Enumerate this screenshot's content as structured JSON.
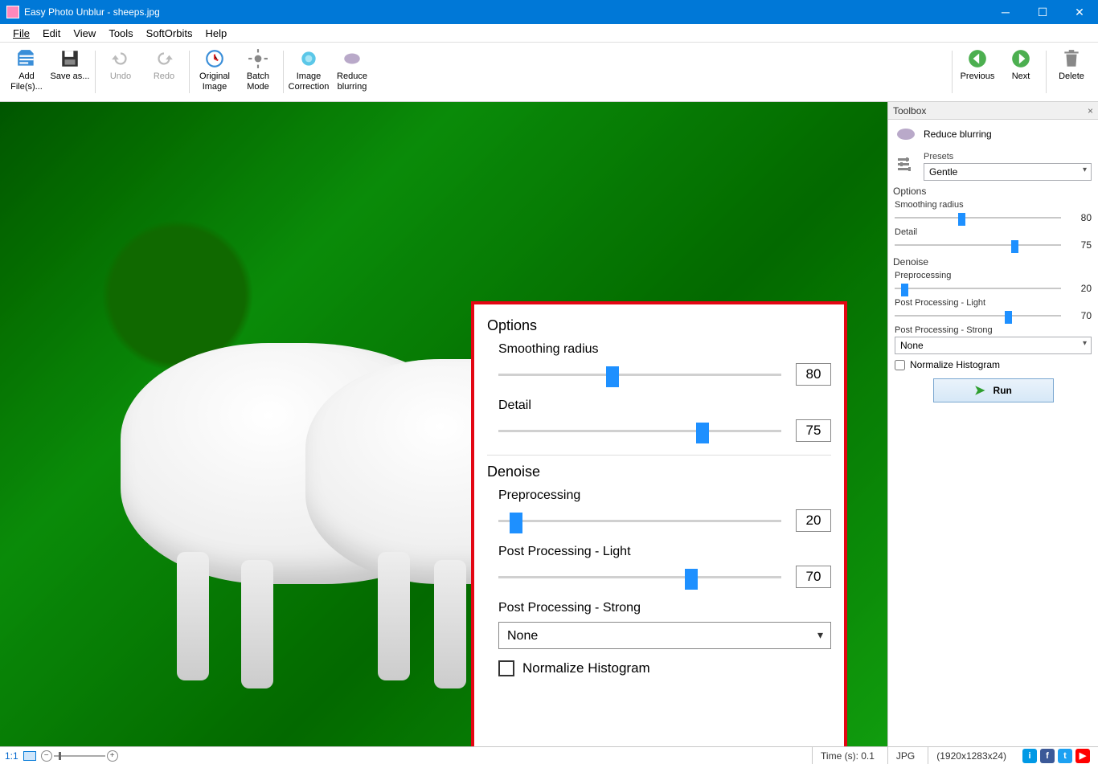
{
  "titlebar": {
    "title": "Easy Photo Unblur - sheeps.jpg"
  },
  "menu": {
    "file": "File",
    "edit": "Edit",
    "view": "View",
    "tools": "Tools",
    "softorbits": "SoftOrbits",
    "help": "Help"
  },
  "toolbar": {
    "add": "Add File(s)...",
    "save": "Save as...",
    "undo": "Undo",
    "redo": "Redo",
    "original": "Original Image",
    "batch": "Batch Mode",
    "correction": "Image Correction",
    "reduce": "Reduce blurring",
    "previous": "Previous",
    "next": "Next",
    "delete": "Delete"
  },
  "toolbox": {
    "header": "Toolbox",
    "title": "Reduce blurring",
    "presets_label": "Presets",
    "presets_value": "Gentle",
    "options_label": "Options",
    "smoothing_label": "Smoothing radius",
    "smoothing_value": "80",
    "detail_label": "Detail",
    "detail_value": "75",
    "denoise_label": "Denoise",
    "preprocessing_label": "Preprocessing",
    "preprocessing_value": "20",
    "pplight_label": "Post Processing - Light",
    "pplight_value": "70",
    "ppstrong_label": "Post Processing - Strong",
    "ppstrong_value": "None",
    "normalize_label": "Normalize Histogram",
    "run_label": "Run"
  },
  "overlay": {
    "options": "Options",
    "smoothing_label": "Smoothing radius",
    "smoothing_value": "80",
    "detail_label": "Detail",
    "detail_value": "75",
    "denoise": "Denoise",
    "preprocessing_label": "Preprocessing",
    "preprocessing_value": "20",
    "pplight_label": "Post Processing - Light",
    "pplight_value": "70",
    "ppstrong_label": "Post Processing - Strong",
    "ppstrong_value": "None",
    "normalize_label": "Normalize Histogram"
  },
  "statusbar": {
    "zoom": "1:1",
    "time": "Time (s): 0.1",
    "format": "JPG",
    "dims": "(1920x1283x24)"
  }
}
